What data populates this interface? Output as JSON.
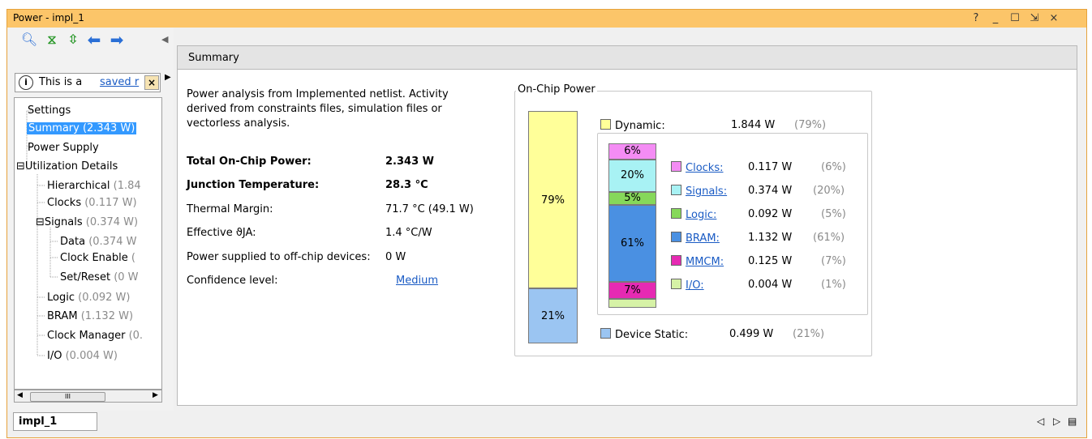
{
  "window": {
    "title": "Power - impl_1",
    "buttons": [
      "?",
      "_",
      "☐",
      "⇲",
      "×"
    ]
  },
  "toolbar": {
    "icons": [
      "search-icon",
      "collapse-all-icon",
      "expand-all-icon",
      "back-arrow-icon",
      "forward-arrow-icon"
    ]
  },
  "info": {
    "text": "This is a",
    "link": "saved r"
  },
  "tree": [
    {
      "label": "Settings",
      "value": ""
    },
    {
      "label": "Summary (2.343 W)",
      "value": "",
      "selected": true
    },
    {
      "label": "Power Supply",
      "value": ""
    },
    {
      "label": "Utilization Details",
      "value": "",
      "expand": "⊟"
    },
    {
      "label": "Hierarchical",
      "value": "(1.84"
    },
    {
      "label": "Clocks",
      "value": "(0.117 W)"
    },
    {
      "label": "Signals",
      "value": "(0.374 W)",
      "expand": "⊟"
    },
    {
      "label": "Data",
      "value": "(0.374 W"
    },
    {
      "label": "Clock Enable",
      "value": "("
    },
    {
      "label": "Set/Reset",
      "value": "(0 W"
    },
    {
      "label": "Logic",
      "value": "(0.092 W)"
    },
    {
      "label": "BRAM",
      "value": "(1.132 W)"
    },
    {
      "label": "Clock Manager",
      "value": "(0."
    },
    {
      "label": "I/O",
      "value": "(0.004 W)"
    }
  ],
  "scroll": {
    "thumb": "III"
  },
  "summary": {
    "tab": "Summary",
    "intro": [
      "Power analysis from Implemented netlist. Activity",
      "derived from constraints files, simulation files or",
      "vectorless analysis."
    ],
    "rows": [
      {
        "label": "Total On-Chip Power:",
        "value": "2.343 W",
        "bold": true
      },
      {
        "label": "Junction Temperature:",
        "value": "28.3 °C",
        "bold": true
      },
      {
        "label": "Thermal Margin:",
        "value": "71.7 °C (49.1 W)"
      },
      {
        "label": "Effective ϑJA:",
        "value": "1.4 °C/W"
      },
      {
        "label": "Power supplied to off-chip devices:",
        "value": "0 W"
      },
      {
        "label": "Confidence level:",
        "value": "Medium",
        "link": true
      }
    ]
  },
  "chart": {
    "title": "On-Chip Power",
    "dynamic": {
      "label": "Dynamic:",
      "value": "1.844 W",
      "pct": "(79%)",
      "bar": "79%",
      "color": "#ffff99"
    },
    "static": {
      "label": "Device Static:",
      "value": "0.499 W",
      "pct": "(21%)",
      "bar": "21%",
      "color": "#9bc5f2"
    },
    "items": [
      {
        "label": "Clocks:",
        "value": "0.117 W",
        "pct": "(6%)",
        "bar": "6%",
        "color": "#f48cf4"
      },
      {
        "label": "Signals:",
        "value": "0.374 W",
        "pct": "(20%)",
        "bar": "20%",
        "color": "#a8f2f4"
      },
      {
        "label": "Logic:",
        "value": "0.092 W",
        "pct": "(5%)",
        "bar": "5%",
        "color": "#86d85a"
      },
      {
        "label": "BRAM:",
        "value": "1.132 W",
        "pct": "(61%)",
        "bar": "61%",
        "color": "#4a90e2"
      },
      {
        "label": "MMCM:",
        "value": "0.125 W",
        "pct": "(7%)",
        "bar": "7%",
        "color": "#e62ab3"
      },
      {
        "label": "I/O:",
        "value": "0.004 W",
        "pct": "(1%)",
        "bar": "",
        "color": "#d6f2a6"
      }
    ]
  },
  "bottom": {
    "tab": "impl_1",
    "nav": [
      "◁",
      "▷",
      "▤"
    ]
  }
}
